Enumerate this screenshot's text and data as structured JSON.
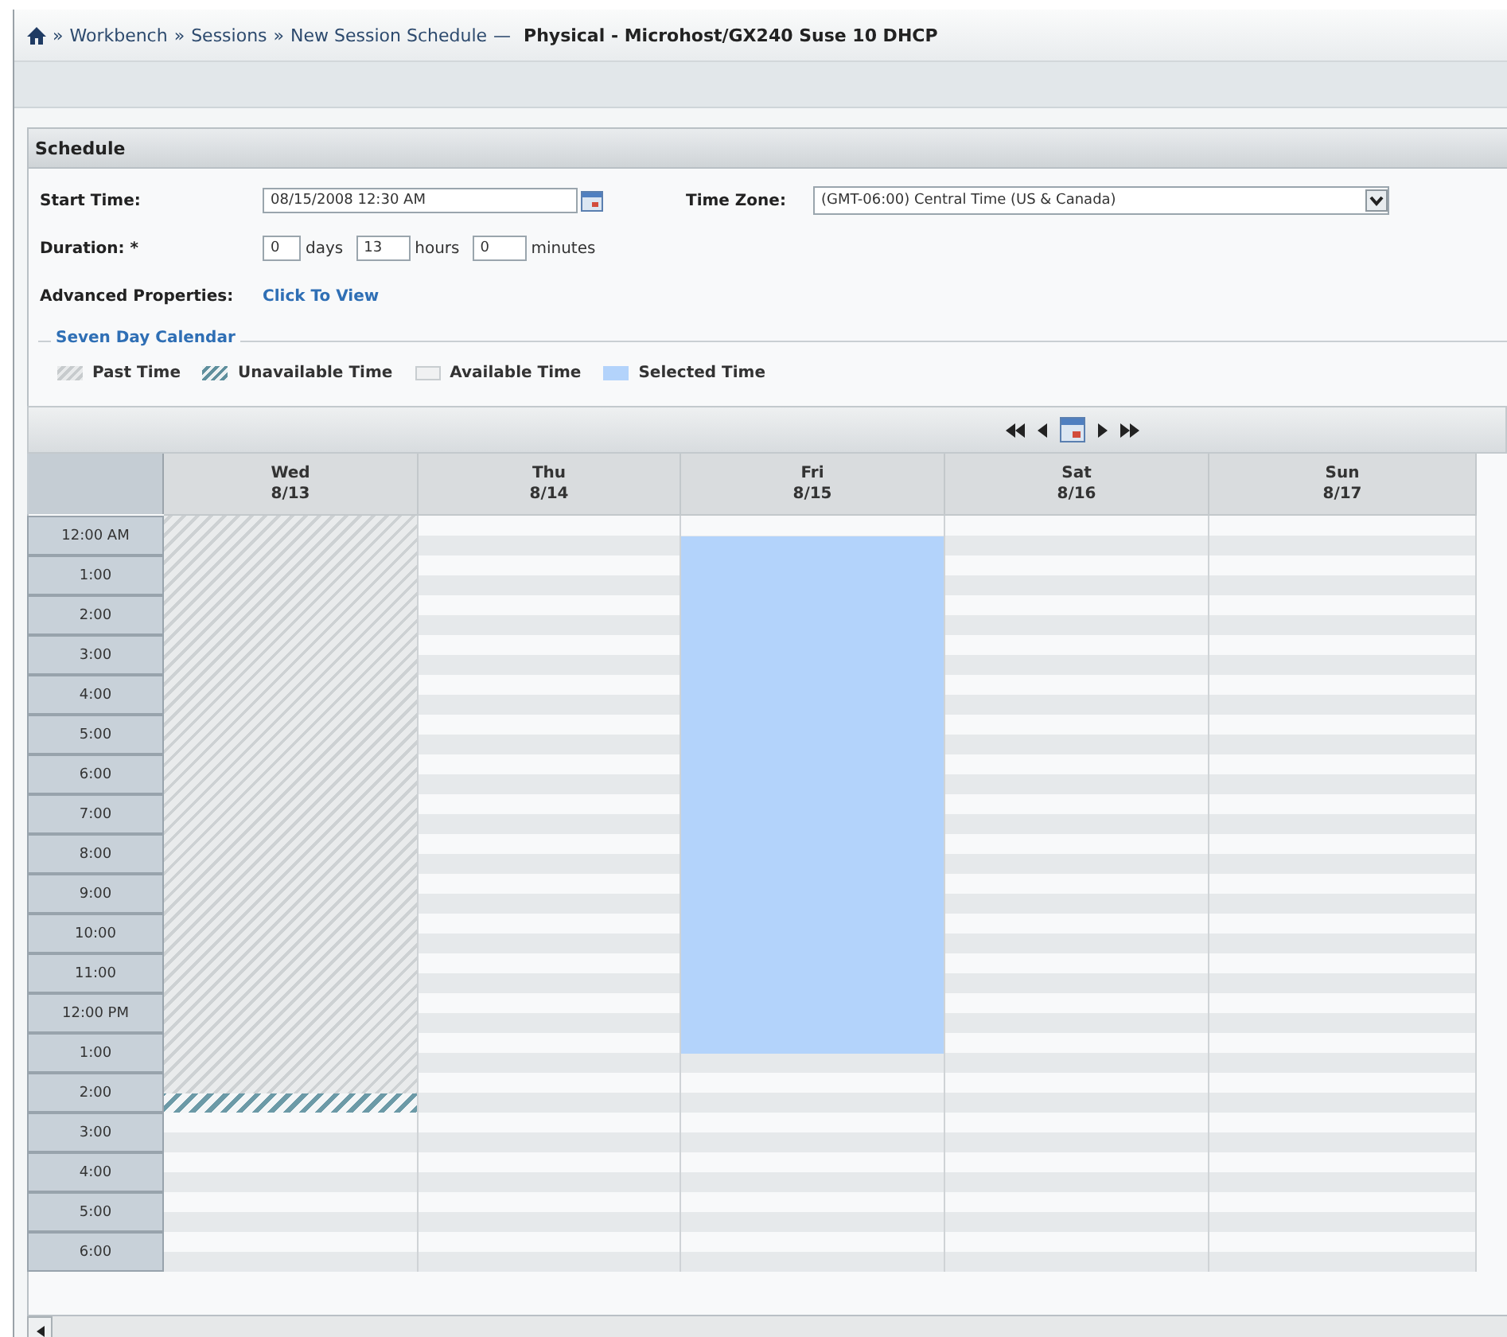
{
  "breadcrumb": {
    "items": [
      "Workbench",
      "Sessions",
      "New Session Schedule"
    ],
    "separator": "»",
    "dash": "—",
    "current": "Physical - Microhost/GX240 Suse 10 DHCP"
  },
  "panel": {
    "title": "Schedule"
  },
  "form": {
    "start_time": {
      "label": "Start Time:",
      "value": "08/15/2008 12:30 AM"
    },
    "time_zone": {
      "label": "Time Zone:",
      "value": "(GMT-06:00) Central Time (US & Canada)"
    },
    "duration": {
      "label": "Duration:",
      "required": "*",
      "fields": [
        {
          "value": "0",
          "unit": "days"
        },
        {
          "value": "13",
          "unit": "hours"
        },
        {
          "value": "0",
          "unit": "minutes"
        }
      ]
    },
    "advanced": {
      "label": "Advanced Properties:",
      "link": "Click To View"
    }
  },
  "calendar": {
    "title": "Seven Day Calendar",
    "legend": [
      {
        "kind": "past",
        "label": "Past Time"
      },
      {
        "kind": "unavailable",
        "label": "Unavailable Time"
      },
      {
        "kind": "available",
        "label": "Available Time"
      },
      {
        "kind": "selected",
        "label": "Selected Time"
      }
    ],
    "hours": [
      "12:00 AM",
      "1:00",
      "2:00",
      "3:00",
      "4:00",
      "5:00",
      "6:00",
      "7:00",
      "8:00",
      "9:00",
      "10:00",
      "11:00",
      "12:00 PM",
      "1:00",
      "2:00",
      "3:00",
      "4:00",
      "5:00",
      "6:00"
    ],
    "days": [
      {
        "day": "Wed",
        "date": "8/13",
        "slots": [
          {
            "kind": "past"
          },
          {
            "kind": "past"
          },
          {
            "kind": "past"
          },
          {
            "kind": "past"
          },
          {
            "kind": "past"
          },
          {
            "kind": "past"
          },
          {
            "kind": "past"
          },
          {
            "kind": "past"
          },
          {
            "kind": "past"
          },
          {
            "kind": "past"
          },
          {
            "kind": "past"
          },
          {
            "kind": "past"
          },
          {
            "kind": "past"
          },
          {
            "kind": "past"
          },
          {
            "kind": "past"
          },
          {
            "kind": "past"
          },
          {
            "kind": "past"
          },
          {
            "kind": "past"
          },
          {
            "kind": "past"
          },
          {
            "kind": "past"
          },
          {
            "kind": "past"
          },
          {
            "kind": "past"
          },
          {
            "kind": "past"
          },
          {
            "kind": "past"
          },
          {
            "kind": "past"
          },
          {
            "kind": "past"
          },
          {
            "kind": "past"
          },
          {
            "kind": "past"
          },
          {
            "kind": "past"
          },
          {
            "kind": "unavailable"
          },
          {
            "kind": "available"
          },
          {
            "kind": "available"
          },
          {
            "kind": "available"
          },
          {
            "kind": "available"
          },
          {
            "kind": "available"
          },
          {
            "kind": "available"
          },
          {
            "kind": "available"
          },
          {
            "kind": "available"
          }
        ]
      },
      {
        "day": "Thu",
        "date": "8/14",
        "slots": [
          {
            "kind": "available"
          },
          {
            "kind": "available"
          },
          {
            "kind": "available"
          },
          {
            "kind": "available"
          },
          {
            "kind": "available"
          },
          {
            "kind": "available"
          },
          {
            "kind": "available"
          },
          {
            "kind": "available"
          },
          {
            "kind": "available"
          },
          {
            "kind": "available"
          },
          {
            "kind": "available"
          },
          {
            "kind": "available"
          },
          {
            "kind": "available"
          },
          {
            "kind": "available"
          },
          {
            "kind": "available"
          },
          {
            "kind": "available"
          },
          {
            "kind": "available"
          },
          {
            "kind": "available"
          },
          {
            "kind": "available"
          },
          {
            "kind": "available"
          },
          {
            "kind": "available"
          },
          {
            "kind": "available"
          },
          {
            "kind": "available"
          },
          {
            "kind": "available"
          },
          {
            "kind": "available"
          },
          {
            "kind": "available"
          },
          {
            "kind": "available"
          },
          {
            "kind": "available"
          },
          {
            "kind": "available"
          },
          {
            "kind": "available"
          },
          {
            "kind": "available"
          },
          {
            "kind": "available"
          },
          {
            "kind": "available"
          },
          {
            "kind": "available"
          },
          {
            "kind": "available"
          },
          {
            "kind": "available"
          },
          {
            "kind": "available"
          },
          {
            "kind": "available"
          }
        ]
      },
      {
        "day": "Fri",
        "date": "8/15",
        "slots": [
          {
            "kind": "available"
          },
          {
            "kind": "selected"
          },
          {
            "kind": "selected"
          },
          {
            "kind": "selected"
          },
          {
            "kind": "selected"
          },
          {
            "kind": "selected"
          },
          {
            "kind": "selected"
          },
          {
            "kind": "selected"
          },
          {
            "kind": "selected"
          },
          {
            "kind": "selected"
          },
          {
            "kind": "selected"
          },
          {
            "kind": "selected"
          },
          {
            "kind": "selected"
          },
          {
            "kind": "selected"
          },
          {
            "kind": "selected"
          },
          {
            "kind": "selected"
          },
          {
            "kind": "selected"
          },
          {
            "kind": "selected"
          },
          {
            "kind": "selected"
          },
          {
            "kind": "selected"
          },
          {
            "kind": "selected"
          },
          {
            "kind": "selected"
          },
          {
            "kind": "selected"
          },
          {
            "kind": "selected"
          },
          {
            "kind": "selected"
          },
          {
            "kind": "selected"
          },
          {
            "kind": "selected"
          },
          {
            "kind": "available"
          },
          {
            "kind": "available"
          },
          {
            "kind": "available"
          },
          {
            "kind": "available"
          },
          {
            "kind": "available"
          },
          {
            "kind": "available"
          },
          {
            "kind": "available"
          },
          {
            "kind": "available"
          },
          {
            "kind": "available"
          },
          {
            "kind": "available"
          },
          {
            "kind": "available"
          }
        ]
      },
      {
        "day": "Sat",
        "date": "8/16",
        "slots": [
          {
            "kind": "available"
          },
          {
            "kind": "available"
          },
          {
            "kind": "available"
          },
          {
            "kind": "available"
          },
          {
            "kind": "available"
          },
          {
            "kind": "available"
          },
          {
            "kind": "available"
          },
          {
            "kind": "available"
          },
          {
            "kind": "available"
          },
          {
            "kind": "available"
          },
          {
            "kind": "available"
          },
          {
            "kind": "available"
          },
          {
            "kind": "available"
          },
          {
            "kind": "available"
          },
          {
            "kind": "available"
          },
          {
            "kind": "available"
          },
          {
            "kind": "available"
          },
          {
            "kind": "available"
          },
          {
            "kind": "available"
          },
          {
            "kind": "available"
          },
          {
            "kind": "available"
          },
          {
            "kind": "available"
          },
          {
            "kind": "available"
          },
          {
            "kind": "available"
          },
          {
            "kind": "available"
          },
          {
            "kind": "available"
          },
          {
            "kind": "available"
          },
          {
            "kind": "available"
          },
          {
            "kind": "available"
          },
          {
            "kind": "available"
          },
          {
            "kind": "available"
          },
          {
            "kind": "available"
          },
          {
            "kind": "available"
          },
          {
            "kind": "available"
          },
          {
            "kind": "available"
          },
          {
            "kind": "available"
          },
          {
            "kind": "available"
          },
          {
            "kind": "available"
          }
        ]
      },
      {
        "day": "Sun",
        "date": "8/17",
        "slots": [
          {
            "kind": "available"
          },
          {
            "kind": "available"
          },
          {
            "kind": "available"
          },
          {
            "kind": "available"
          },
          {
            "kind": "available"
          },
          {
            "kind": "available"
          },
          {
            "kind": "available"
          },
          {
            "kind": "available"
          },
          {
            "kind": "available"
          },
          {
            "kind": "available"
          },
          {
            "kind": "available"
          },
          {
            "kind": "available"
          },
          {
            "kind": "available"
          },
          {
            "kind": "available"
          },
          {
            "kind": "available"
          },
          {
            "kind": "available"
          },
          {
            "kind": "available"
          },
          {
            "kind": "available"
          },
          {
            "kind": "available"
          },
          {
            "kind": "available"
          },
          {
            "kind": "available"
          },
          {
            "kind": "available"
          },
          {
            "kind": "available"
          },
          {
            "kind": "available"
          },
          {
            "kind": "available"
          },
          {
            "kind": "available"
          },
          {
            "kind": "available"
          },
          {
            "kind": "available"
          },
          {
            "kind": "available"
          },
          {
            "kind": "available"
          },
          {
            "kind": "available"
          },
          {
            "kind": "available"
          },
          {
            "kind": "available"
          },
          {
            "kind": "available"
          },
          {
            "kind": "available"
          },
          {
            "kind": "available"
          },
          {
            "kind": "available"
          },
          {
            "kind": "available"
          }
        ]
      }
    ]
  }
}
